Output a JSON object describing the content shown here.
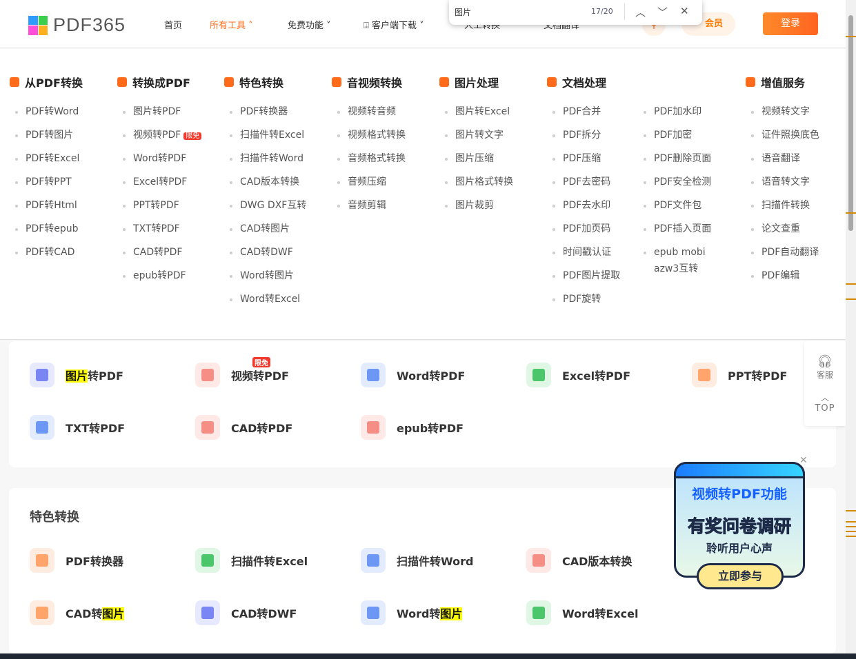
{
  "header": {
    "logo": "PDF365",
    "nav": [
      "首页",
      "所有工具",
      "免费功能",
      "客户端下载",
      "人工转换",
      "文档翻译"
    ],
    "vip": "会员",
    "login": "登录"
  },
  "find": {
    "query": "图片",
    "count": "17/20"
  },
  "menu": [
    {
      "title": "从PDF转换",
      "items": [
        "PDF转Word",
        "PDF转图片",
        "PDF转Excel",
        "PDF转PPT",
        "PDF转Html",
        "PDF转epub",
        "PDF转CAD"
      ]
    },
    {
      "title": "转换成PDF",
      "items": [
        "图片转PDF",
        "视频转PDF",
        "Word转PDF",
        "Excel转PDF",
        "PPT转PDF",
        "TXT转PDF",
        "CAD转PDF",
        "epub转PDF"
      ]
    },
    {
      "title": "特色转换",
      "items": [
        "PDF转换器",
        "扫描件转Excel",
        "扫描件转Word",
        "CAD版本转换",
        "DWG DXF互转",
        "CAD转图片",
        "CAD转DWF",
        "Word转图片",
        "Word转Excel"
      ]
    },
    {
      "title": "音视频转换",
      "items": [
        "视频转音频",
        "视频格式转换",
        "音频格式转换",
        "音频压缩",
        "音频剪辑"
      ]
    },
    {
      "title": "图片处理",
      "items": [
        "图片转Excel",
        "图片转文字",
        "图片压缩",
        "图片格式转换",
        "图片裁剪"
      ]
    },
    {
      "title": "文档处理",
      "items": [
        "PDF合并",
        "PDF拆分",
        "PDF压缩",
        "PDF去密码",
        "PDF去水印",
        "PDF加页码",
        "时间戳认证",
        "PDF图片提取",
        "PDF旋转"
      ],
      "items2": [
        "PDF加水印",
        "PDF加密",
        "PDF删除页面",
        "PDF安全检测",
        "PDF文件包",
        "PDF插入页面",
        "epub mobi azw3互转"
      ]
    },
    {
      "title": "增值服务",
      "items": [
        "视频转文字",
        "证件照换底色",
        "语音翻译",
        "语音转文字",
        "扫描件转换",
        "论文查重",
        "PDF自动翻译",
        "PDF编辑"
      ]
    }
  ],
  "free_badge": "限免",
  "section1": {
    "tools": [
      "图片转PDF",
      "视频转PDF",
      "Word转PDF",
      "Excel转PDF",
      "PPT转PDF",
      "TXT转PDF",
      "CAD转PDF",
      "epub转PDF"
    ]
  },
  "section2": {
    "title": "特色转换",
    "tools": [
      "PDF转换器",
      "扫描件转Excel",
      "扫描件转Word",
      "CAD版本转换",
      "CAD转图片",
      "CAD转DWF",
      "Word转图片",
      "Word转Excel"
    ]
  },
  "float": {
    "service": "客服",
    "top": "TOP"
  },
  "promo": {
    "line1": "视频转PDF功能",
    "line2": "有奖问卷调研",
    "line3": "聆听用户心声",
    "button": "立即参与"
  },
  "colors": {
    "accent": "#ff6b1a",
    "highlight": "#ffff00"
  }
}
